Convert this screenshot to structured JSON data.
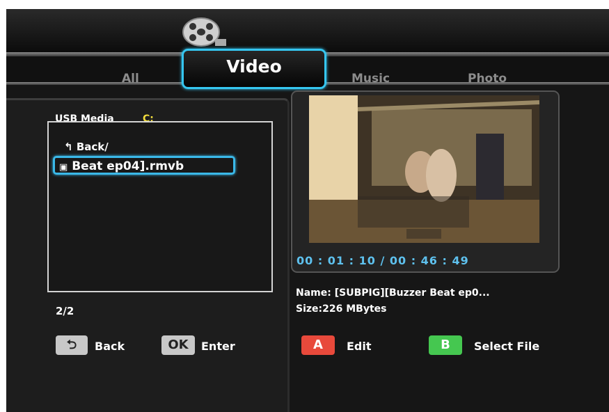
{
  "tabs": {
    "all": "All",
    "video": "Video",
    "music": "Music",
    "photo": "Photo"
  },
  "browser": {
    "device_label": "USB Media",
    "drive": "C:",
    "back_item": "Back/",
    "selected_file": "Beat ep04].rmvb",
    "page": "2/2"
  },
  "preview": {
    "time": "00 : 01 : 10 / 00 : 46 : 49",
    "name": "Name: [SUBPIG][Buzzer Beat ep0...",
    "size": "Size:226  MBytes"
  },
  "buttons": {
    "back_icon": "⮌",
    "back": "Back",
    "ok_icon": "OK",
    "enter": "Enter",
    "a_icon": "A",
    "edit": "Edit",
    "b_icon": "B",
    "select_file": "Select File"
  },
  "colors": {
    "accent": "#35c6f0",
    "button_a": "#e8493b",
    "button_b": "#45c750",
    "drive": "#f2dc3c"
  }
}
